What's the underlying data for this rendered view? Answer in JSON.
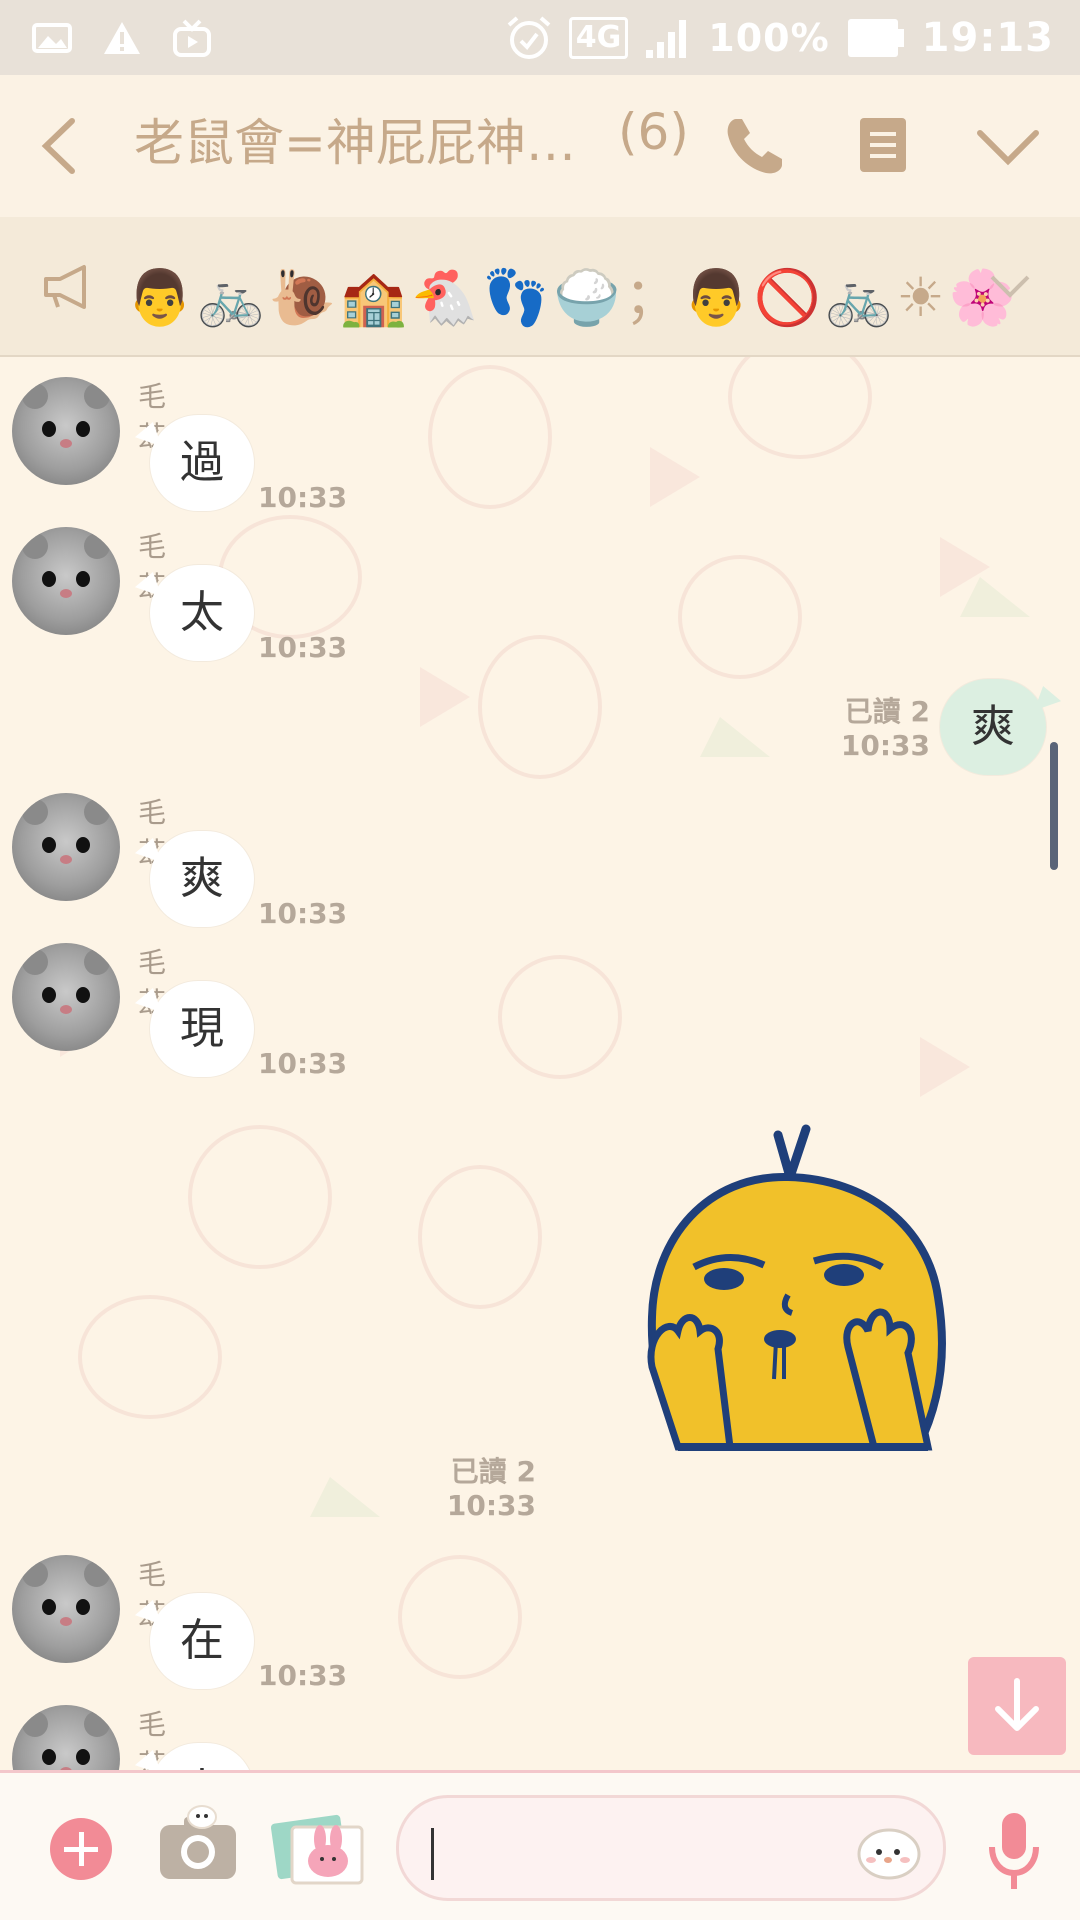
{
  "status_bar": {
    "network": "4G",
    "battery": "100%",
    "time": "19:13",
    "icons": [
      "image-icon",
      "warning-icon",
      "tv-icon",
      "alarm-icon",
      "signal-icon",
      "battery-icon"
    ]
  },
  "header": {
    "title": "老鼠會=神屁屁神…",
    "member_count": "(6)",
    "icons": [
      "back-icon",
      "phone-icon",
      "notes-icon",
      "chevron-down-icon"
    ]
  },
  "announcement": {
    "text": "👨🚲🐌🏫🐔👣🍚；👨🚫🚲☀🌸",
    "icons": [
      "megaphone-icon",
      "expand-chevron-icon"
    ]
  },
  "messages": [
    {
      "type": "incoming",
      "sender": "毛茲",
      "text": "過",
      "time": "10:33"
    },
    {
      "type": "incoming",
      "sender": "毛茲",
      "text": "太",
      "time": "10:33"
    },
    {
      "type": "outgoing",
      "read": "已讀 2",
      "text": "爽",
      "time": "10:33"
    },
    {
      "type": "incoming",
      "sender": "毛茲",
      "text": "爽",
      "time": "10:33"
    },
    {
      "type": "incoming",
      "sender": "毛茲",
      "text": "現",
      "time": "10:33"
    },
    {
      "type": "outgoing-sticker",
      "read": "已讀 2",
      "time": "10:33"
    },
    {
      "type": "incoming",
      "sender": "毛茲",
      "text": "在",
      "time": "10:33"
    },
    {
      "type": "incoming",
      "sender": "毛茲",
      "text": "去",
      "time": ""
    }
  ],
  "input": {
    "value": "",
    "icons": [
      "plus-icon",
      "camera-icon",
      "gallery-icon",
      "sticker-icon",
      "mic-icon"
    ]
  },
  "colors": {
    "chat_bg": "#fdf4e6",
    "header_text": "#c6a98a",
    "outgoing_bubble": "#dcefe1",
    "accent_pink": "#f28b96"
  }
}
